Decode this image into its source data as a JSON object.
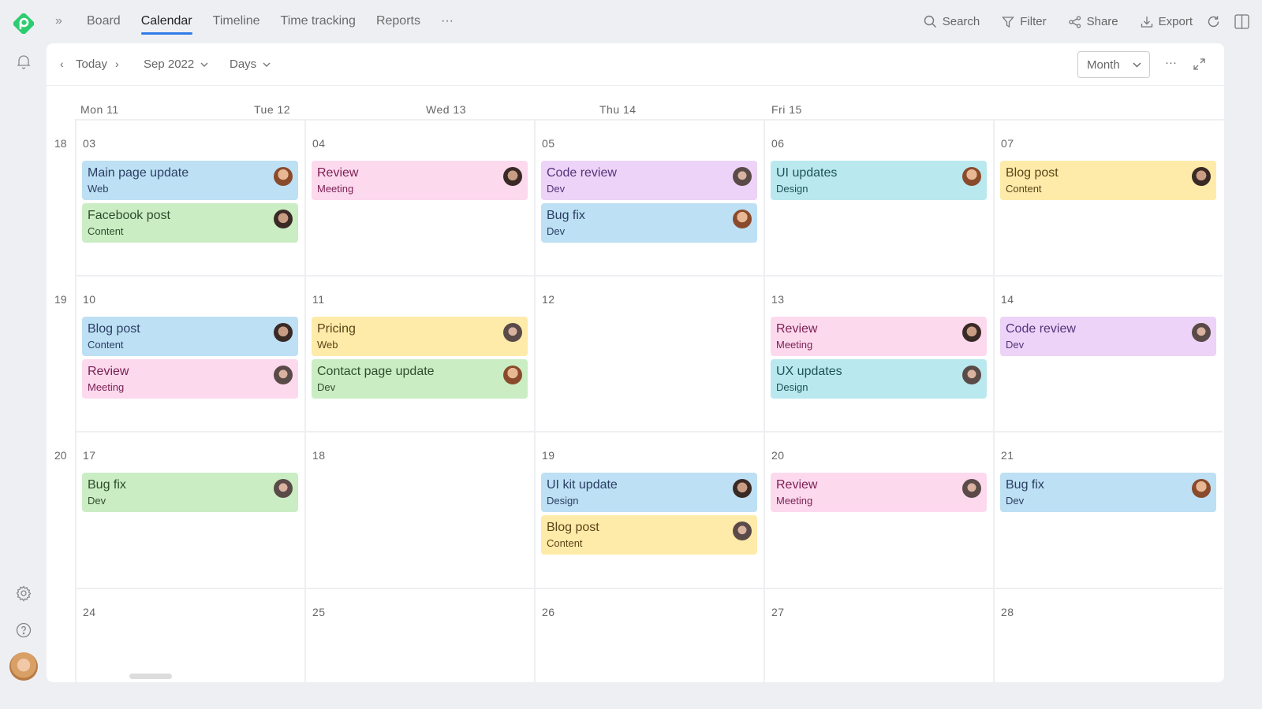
{
  "nav": {
    "tabs": [
      {
        "label": "Board",
        "active": false
      },
      {
        "label": "Calendar",
        "active": true
      },
      {
        "label": "Timeline",
        "active": false
      },
      {
        "label": "Time tracking",
        "active": false
      },
      {
        "label": "Reports",
        "active": false
      },
      {
        "label": "···",
        "active": false
      }
    ],
    "tools": [
      {
        "label": "Search",
        "icon": "search-icon"
      },
      {
        "label": "Filter",
        "icon": "filter-icon"
      },
      {
        "label": "Share",
        "icon": "share-icon"
      },
      {
        "label": "Export",
        "icon": "export-icon"
      }
    ]
  },
  "toolbar": {
    "today": "Today",
    "month_year": "Sep 2022",
    "granularity": "Days",
    "view": "Month",
    "more": "···"
  },
  "day_headers": [
    "Mon 11",
    "Tue 12",
    "Wed 13",
    "Thu 14",
    "Fri 15"
  ],
  "colors": {
    "accent": "#2f7be8",
    "logo": "#2ecc71"
  },
  "weeks": [
    {
      "week": "18",
      "days": [
        {
          "date": "03",
          "events": [
            {
              "title": "Main page update",
              "tag": "Web",
              "color": "blue"
            },
            {
              "title": "Facebook post",
              "tag": "Content",
              "color": "green"
            }
          ]
        },
        {
          "date": "04",
          "events": [
            {
              "title": "Review",
              "tag": "Meeting",
              "color": "pink"
            }
          ]
        },
        {
          "date": "05",
          "events": [
            {
              "title": "Code review",
              "tag": "Dev",
              "color": "purple"
            },
            {
              "title": "Bug fix",
              "tag": "Dev",
              "color": "blue"
            }
          ]
        },
        {
          "date": "06",
          "events": [
            {
              "title": "UI updates",
              "tag": "Design",
              "color": "cyan"
            }
          ]
        },
        {
          "date": "07",
          "events": [
            {
              "title": "Blog post",
              "tag": "Content",
              "color": "yellow"
            }
          ]
        }
      ]
    },
    {
      "week": "19",
      "days": [
        {
          "date": "10",
          "events": [
            {
              "title": "Blog post",
              "tag": "Content",
              "color": "blue"
            },
            {
              "title": "Review",
              "tag": "Meeting",
              "color": "pink"
            }
          ]
        },
        {
          "date": "11",
          "events": [
            {
              "title": "Pricing",
              "tag": "Web",
              "color": "yellow"
            },
            {
              "title": "Contact page update",
              "tag": "Dev",
              "color": "green"
            }
          ]
        },
        {
          "date": "12",
          "events": []
        },
        {
          "date": "13",
          "events": [
            {
              "title": "Review",
              "tag": "Meeting",
              "color": "pink"
            },
            {
              "title": "UX updates",
              "tag": "Design",
              "color": "cyan"
            }
          ]
        },
        {
          "date": "14",
          "events": [
            {
              "title": "Code review",
              "tag": "Dev",
              "color": "purple"
            }
          ]
        }
      ]
    },
    {
      "week": "20",
      "days": [
        {
          "date": "17",
          "events": [
            {
              "title": "Bug fix",
              "tag": "Dev",
              "color": "green"
            }
          ]
        },
        {
          "date": "18",
          "events": []
        },
        {
          "date": "19",
          "events": [
            {
              "title": "UI kit update",
              "tag": "Design",
              "color": "blue"
            },
            {
              "title": "Blog post",
              "tag": "Content",
              "color": "yellow"
            }
          ]
        },
        {
          "date": "20",
          "events": [
            {
              "title": "Review",
              "tag": "Meeting",
              "color": "pink"
            }
          ]
        },
        {
          "date": "21",
          "events": [
            {
              "title": "Bug fix",
              "tag": "Dev",
              "color": "blue"
            }
          ]
        }
      ]
    },
    {
      "week": "",
      "days": [
        {
          "date": "24",
          "events": []
        },
        {
          "date": "25",
          "events": []
        },
        {
          "date": "26",
          "events": []
        },
        {
          "date": "27",
          "events": []
        },
        {
          "date": "28",
          "events": []
        }
      ]
    }
  ]
}
